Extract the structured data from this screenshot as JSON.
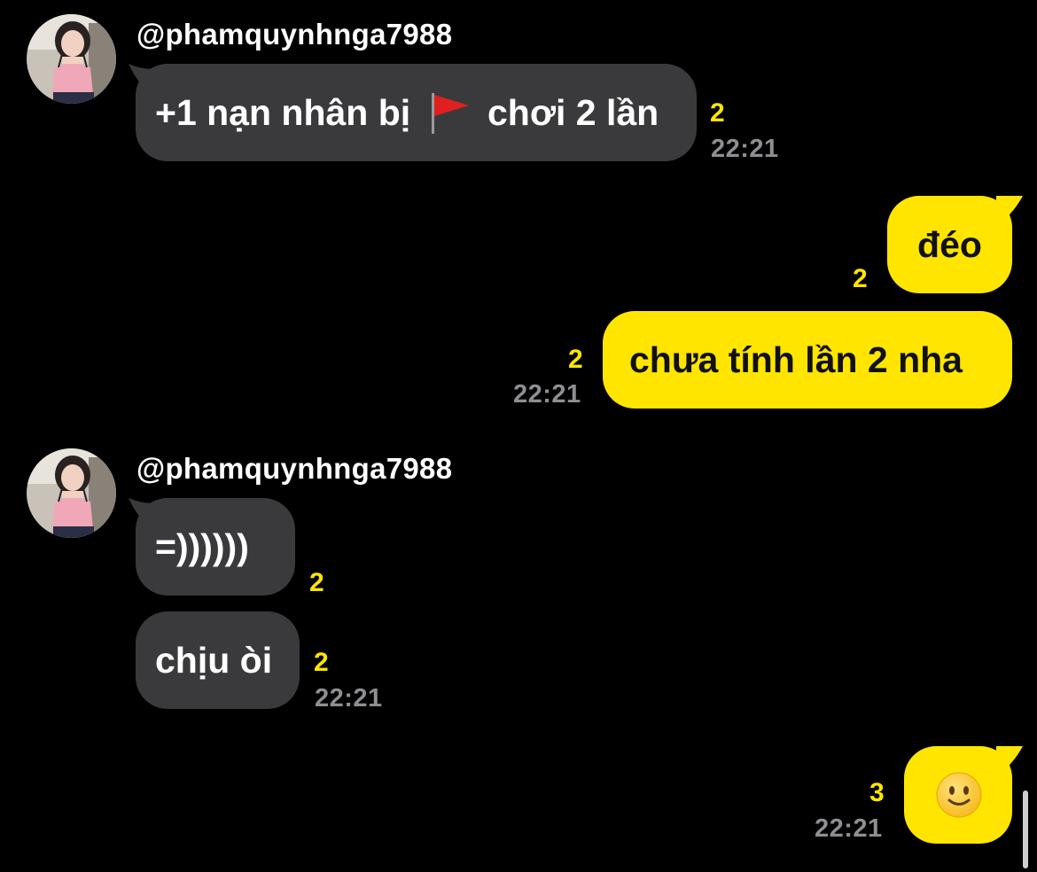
{
  "chat": {
    "group1": {
      "sender": "@phamquynhnga7988",
      "msg1": {
        "before": "+1 nạn nhân bị",
        "icon": "red-flag-icon",
        "after": "chơi 2 lần",
        "unread": "2",
        "time": "22:21"
      }
    },
    "outgoing1": {
      "msg1": {
        "text": "đéo",
        "unread": "2"
      },
      "msg2": {
        "text": "chưa tính lần 2 nha",
        "unread": "2",
        "time": "22:21"
      }
    },
    "group2": {
      "sender": "@phamquynhnga7988",
      "msg1": {
        "text": "=))))))",
        "unread": "2"
      },
      "msg2": {
        "text": "chịu òi",
        "unread": "2",
        "time": "22:21"
      }
    },
    "outgoing2": {
      "msg1": {
        "icon": "slightly-smiling-face-icon",
        "unread": "3",
        "time": "22:21"
      }
    }
  },
  "colors": {
    "background": "#000000",
    "incoming_bubble": "#3a3a3c",
    "outgoing_bubble": "#ffe500",
    "unread_count": "#ffe500",
    "timestamp": "#8e8e93"
  }
}
